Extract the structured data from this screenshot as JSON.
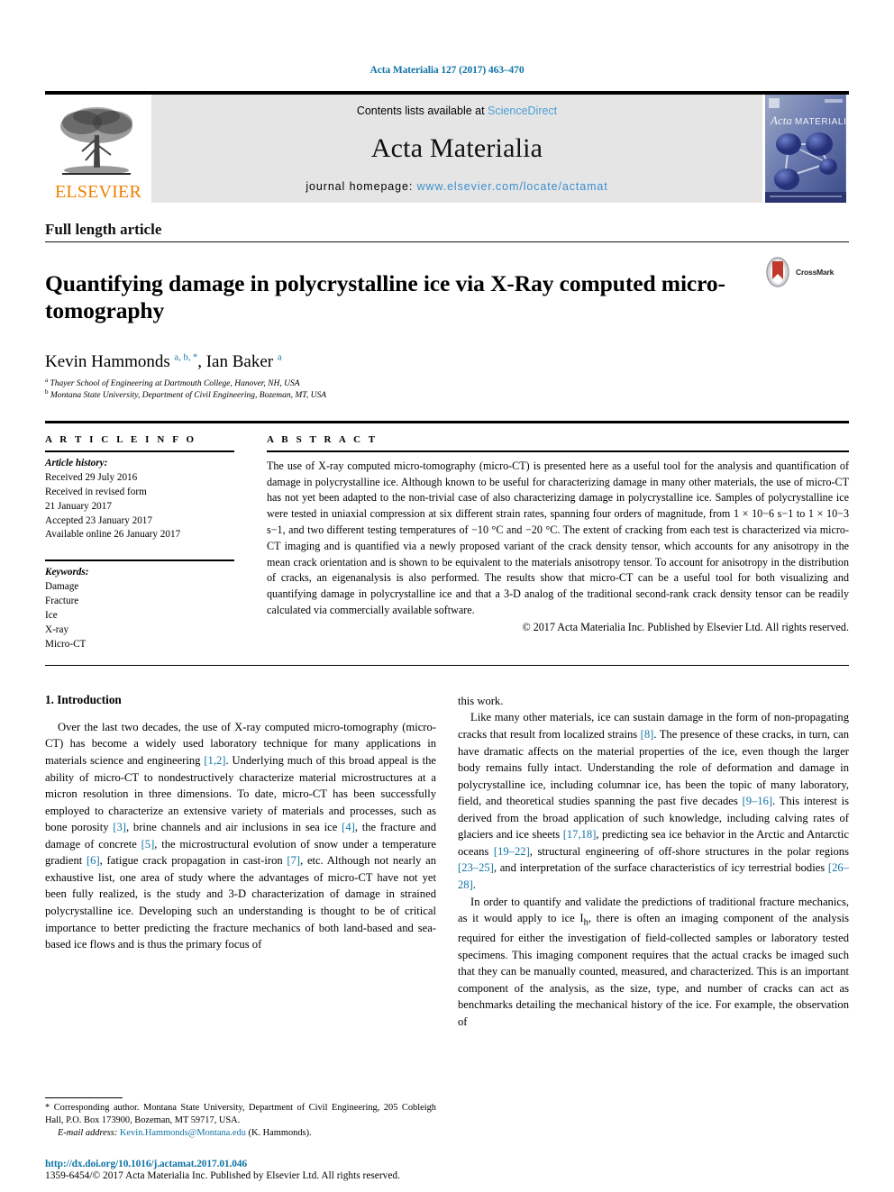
{
  "running_head": "Acta Materialia 127 (2017) 463–470",
  "masthead": {
    "publisher_name": "ELSEVIER",
    "contents_prefix": "Contents lists available at ",
    "contents_link": "ScienceDirect",
    "journal_name": "Acta Materialia",
    "homepage_prefix": "journal homepage: ",
    "homepage_url": "www.elsevier.com/locate/actamat",
    "cover_title": "Acta MATERIALIA"
  },
  "article": {
    "type": "Full length article",
    "title": "Quantifying damage in polycrystalline ice via X-Ray computed micro-tomography",
    "crossmark_label": "CrossMark",
    "authors_html": "Kevin Hammonds <sup>a, b, *</sup>, Ian Baker <sup>a</sup>",
    "affiliation_a": "Thayer School of Engineering at Dartmouth College, Hanover, NH, USA",
    "affiliation_b": "Montana State University, Department of Civil Engineering, Bozeman, MT, USA"
  },
  "info": {
    "heading": "A R T I C L E  I N F O",
    "history_label": "Article history:",
    "history_lines": [
      "Received 29 July 2016",
      "Received in revised form",
      "21 January 2017",
      "Accepted 23 January 2017",
      "Available online 26 January 2017"
    ],
    "keywords_label": "Keywords:",
    "keywords": [
      "Damage",
      "Fracture",
      "Ice",
      "X-ray",
      "Micro-CT"
    ]
  },
  "abstract": {
    "heading": "A B S T R A C T",
    "text": "The use of X-ray computed micro-tomography (micro-CT) is presented here as a useful tool for the analysis and quantification of damage in polycrystalline ice. Although known to be useful for characterizing damage in many other materials, the use of micro-CT has not yet been adapted to the non-trivial case of also characterizing damage in polycrystalline ice. Samples of polycrystalline ice were tested in uniaxial compression at six different strain rates, spanning four orders of magnitude, from 1 × 10−6 s−1 to 1 × 10−3 s−1, and two different testing temperatures of −10 °C and −20 °C. The extent of cracking from each test is characterized via micro-CT imaging and is quantified via a newly proposed variant of the crack density tensor, which accounts for any anisotropy in the mean crack orientation and is shown to be equivalent to the materials anisotropy tensor. To account for anisotropy in the distribution of cracks, an eigenanalysis is also performed. The results show that micro-CT can be a useful tool for both visualizing and quantifying damage in polycrystalline ice and that a 3-D analog of the traditional second-rank crack density tensor can be readily calculated via commercially available software.",
    "copyright": "© 2017 Acta Materialia Inc. Published by Elsevier Ltd. All rights reserved."
  },
  "introduction": {
    "section_title": "1. Introduction",
    "left_para_1_html": "Over the last two decades, the use of X-ray computed micro-tomography (micro-CT) has become a widely used laboratory technique for many applications in materials science and engineering <span class=\"ref\">[1,2]</span>. Underlying much of this broad appeal is the ability of micro-CT to nondestructively characterize material microstructures at a micron resolution in three dimensions. To date, micro-CT has been successfully employed to characterize an extensive variety of materials and processes, such as bone porosity <span class=\"ref\">[3]</span>, brine channels and air inclusions in sea ice <span class=\"ref\">[4]</span>, the fracture and damage of concrete <span class=\"ref\">[5]</span>, the microstructural evolution of snow under a temperature gradient <span class=\"ref\">[6]</span>, fatigue crack propagation in cast-iron <span class=\"ref\">[7]</span>, etc. Although not nearly an exhaustive list, one area of study where the advantages of micro-CT have not yet been fully realized, is the study and 3-D characterization of damage in strained polycrystalline ice. Developing such an understanding is thought to be of critical importance to better predicting the fracture mechanics of both land-based and sea-based ice flows and is thus the primary focus of",
    "right_para_0_html": "this work.",
    "right_para_1_html": "Like many other materials, ice can sustain damage in the form of non-propagating cracks that result from localized strains <span class=\"ref\">[8]</span>. The presence of these cracks, in turn, can have dramatic affects on the material properties of the ice, even though the larger body remains fully intact. Understanding the role of deformation and damage in polycrystalline ice, including columnar ice, has been the topic of many laboratory, field, and theoretical studies spanning the past five decades <span class=\"ref\">[9–16]</span>. This interest is derived from the broad application of such knowledge, including calving rates of glaciers and ice sheets <span class=\"ref\">[17,18]</span>, predicting sea ice behavior in the Arctic and Antarctic oceans <span class=\"ref\">[19–22]</span>, structural engineering of off-shore structures in the polar regions <span class=\"ref\">[23–25]</span>, and interpretation of the surface characteristics of icy terrestrial bodies <span class=\"ref\">[26–28]</span>.",
    "right_para_2_html": "In order to quantify and validate the predictions of traditional fracture mechanics, as it would apply to ice I<sub>h</sub>, there is often an imaging component of the analysis required for either the investigation of field-collected samples or laboratory tested specimens. This imaging component requires that the actual cracks be imaged such that they can be manually counted, measured, and characterized. This is an important component of the analysis, as the size, type, and number of cracks can act as benchmarks detailing the mechanical history of the ice. For example, the observation of"
  },
  "footnotes": {
    "corresponding_html": "* Corresponding author. Montana State University, Department of Civil Engineering, 205 Cobleigh Hall, P.O. Box 173900, Bozeman, MT 59717, USA.",
    "email_label": "E-mail address:",
    "email": "Kevin.Hammonds@Montana.edu",
    "email_suffix": "(K. Hammonds)."
  },
  "footer": {
    "doi": "http://dx.doi.org/10.1016/j.actamat.2017.01.046",
    "issn_copyright": "1359-6454/© 2017 Acta Materialia Inc. Published by Elsevier Ltd. All rights reserved."
  },
  "colors": {
    "link_blue": "#1074a6",
    "sciencedirect_blue": "#4a9fd4",
    "elsevier_orange": "#f08000",
    "masthead_grey": "#e5e5e5"
  }
}
